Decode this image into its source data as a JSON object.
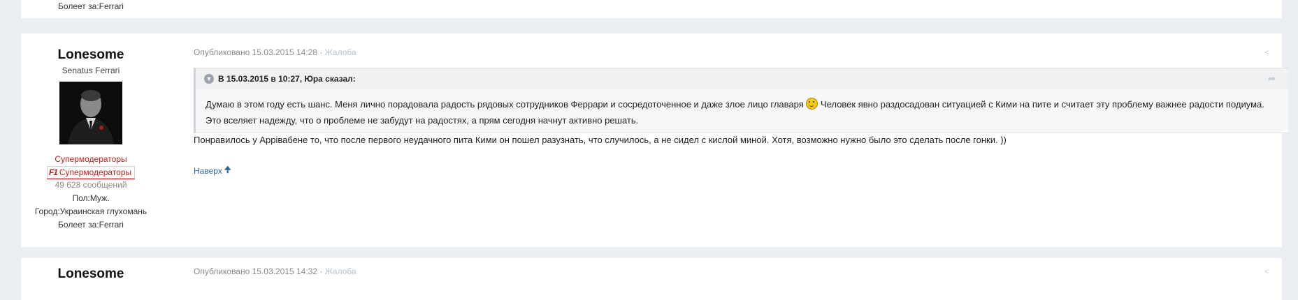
{
  "prev_post": {
    "fan_of": "Болеет за:Ferrari"
  },
  "post": {
    "author": {
      "name": "Lonesome",
      "title": "Senatus Ferrari",
      "group": "Супермодераторы",
      "badge_logo": "F1",
      "badge_label": "Супермодераторы",
      "posts": "49 628 сообщений",
      "gender": "Пол:Муж.",
      "city": "Город:Украинская глухомань",
      "fan_of": "Болеет за:Ferrari"
    },
    "published": "Опубликовано 15.03.2015 14:28",
    "separator": " · ",
    "report": "Жалоба",
    "quote": {
      "header": "В 15.03.2015 в 10:27, Юра сказал:",
      "text_before_smiley": "Думаю в этом году есть шанс. Меня лично порадовала радость рядовых сотрудников Феррари и сосредоточенное и даже злое лицо главаря ",
      "text_after_smiley": " Человек явно раздосадован ситуацией с Кими на пите и считает эту проблему важнее радости подиума. Это вселяет надежду, что о проблеме не забудут на радостях, а прям сегодня начнут активно решать."
    },
    "body": "Понравилось у Аррівабене то, что после первого неудачного пита Кими он пошел разузнать, что случилось, а не сидел с кислой миной. Хотя, возможно нужно было это сделать после гонки. ))",
    "back_to_top": "Наверх",
    "icons": {
      "share": "share-icon",
      "quote_link": "share-arrow-icon",
      "collapse": "chevron-down-icon",
      "back_top": "arrow-up-icon"
    }
  },
  "next_post": {
    "author": {
      "name": "Lonesome"
    },
    "published": "Опубликовано 15.03.2015 14:32",
    "separator": " · ",
    "report": "Жалоба"
  },
  "colors": {
    "group": "#c0201b",
    "link": "#336699",
    "muted": "#8a8a8a",
    "page_bg": "#ebeef2"
  }
}
